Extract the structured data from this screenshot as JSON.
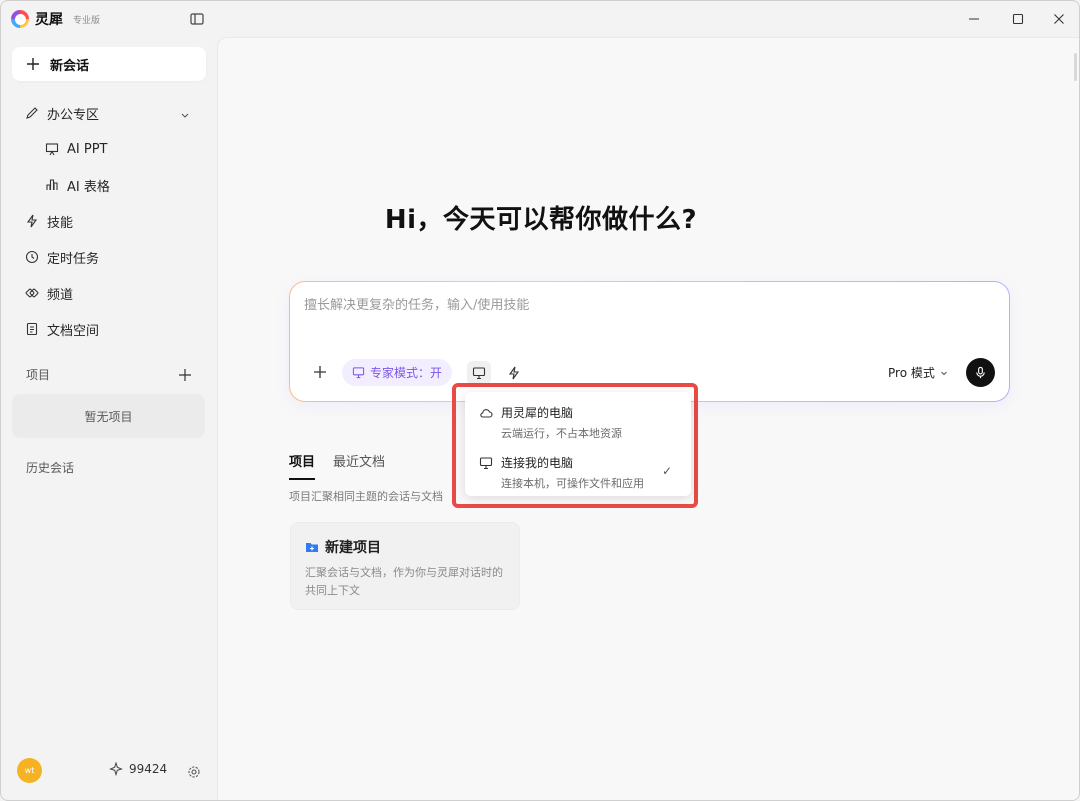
{
  "app": {
    "name": "灵犀",
    "badge": "专业版"
  },
  "sidebar": {
    "new_chat": "新会话",
    "items": [
      {
        "label": "办公专区"
      },
      {
        "label": "AI PPT"
      },
      {
        "label": "AI 表格"
      },
      {
        "label": "技能"
      },
      {
        "label": "定时任务"
      },
      {
        "label": "频道"
      },
      {
        "label": "文档空间"
      }
    ],
    "projects_label": "项目",
    "empty_projects": "暂无项目",
    "history_label": "历史会话",
    "avatar_text": "wt",
    "credits": "99424"
  },
  "main": {
    "greeting": "Hi，今天可以帮你做什么?",
    "input_placeholder": "擅长解决更复杂的任务，输入/使用技能",
    "expert_mode": "专家模式：开",
    "pro_mode": "Pro 模式"
  },
  "dropdown": {
    "options": [
      {
        "title": "用灵犀的电脑",
        "subtitle": "云端运行，不占本地资源",
        "selected": false
      },
      {
        "title": "连接我的电脑",
        "subtitle": "连接本机，可操作文件和应用",
        "selected": true
      }
    ],
    "check": "✓"
  },
  "tabs": [
    {
      "label": "项目",
      "active": true
    },
    {
      "label": "最近文档",
      "active": false
    }
  ],
  "tab_description": "项目汇聚相同主题的会话与文档",
  "project_card": {
    "title": "新建项目",
    "description": "汇聚会话与文档，作为你与灵犀对话时的共同上下文"
  },
  "colors": {
    "accent": "#7b57e4",
    "highlight_border": "#e84a45",
    "avatar": "#f5b324"
  }
}
